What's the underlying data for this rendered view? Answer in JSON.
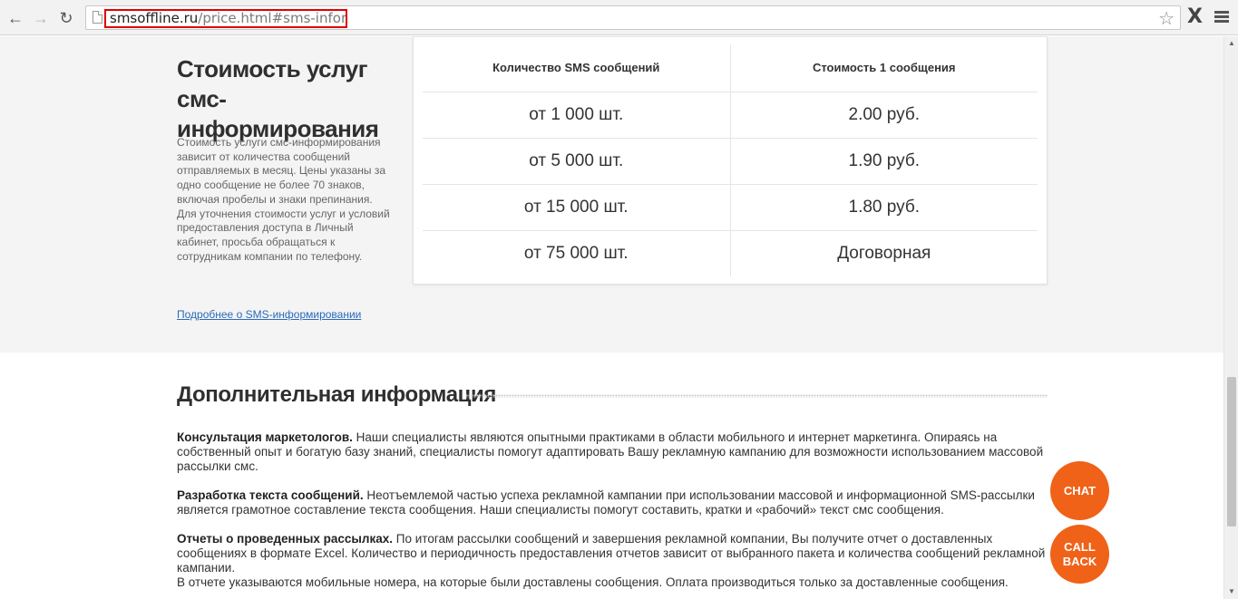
{
  "browser": {
    "url_host": "smsoffline.ru",
    "url_path": "/price.html#sms-inform",
    "ext_label": "X"
  },
  "pricing": {
    "title": "Стоимость услуг смс-информирования",
    "description": "Стоимость услуги смс-информирования зависит от количества сообщений отправляемых в месяц. Цены указаны за одно сообщение не более 70 знаков, включая пробелы и знаки препинания. Для уточнения стоимости услуг и условий предоставления доступа в Личный кабинет, просьба обращаться к сотрудникам компании по телефону.",
    "link": "Подробнее о SMS-информировании",
    "table": {
      "headers": [
        "Количество SMS сообщений",
        "Стоимость 1 сообщения"
      ],
      "rows": [
        [
          "от 1 000 шт.",
          "2.00 руб."
        ],
        [
          "от 5 000 шт.",
          "1.90 руб."
        ],
        [
          "от 15 000 шт.",
          "1.80 руб."
        ],
        [
          "от 75 000 шт.",
          "Договорная"
        ]
      ]
    }
  },
  "info": {
    "title": "Дополнительная информация",
    "paragraphs": [
      {
        "lead": "Консультация маркетологов.",
        "text": " Наши специалисты являются опытными практиками в области мобильного и интернет маркетинга. Опираясь на собственный опыт и богатую базу знаний, специалисты помогут адаптировать Вашу рекламную кампанию для возможности использованием массовой рассылки смс."
      },
      {
        "lead": "Разработка текста сообщений.",
        "text": " Неотъемлемой частью успеха рекламной кампании при использовании массовой и информационной SMS-рассылки является грамотное составление текста сообщения. Наши специалисты помогут составить, кратки и «рабочий» текст смс сообщения."
      },
      {
        "lead": "Отчеты о проведенных рассылках.",
        "text": " По итогам рассылки сообщений и завершения рекламной компании, Вы получите отчет о доставленных сообщениях в формате Excel. Количество и периодичность предоставления отчетов зависит от выбранного пакета и количества сообщений рекламной кампании."
      },
      {
        "lead": "",
        "text": "В отчете указываются мобильные номера, на которые были доставлены сообщения. Оплата производиться только за доставленные сообщения."
      }
    ]
  },
  "widgets": {
    "chat": "CHAT",
    "call_line1": "CALL",
    "call_line2": "BACK"
  }
}
